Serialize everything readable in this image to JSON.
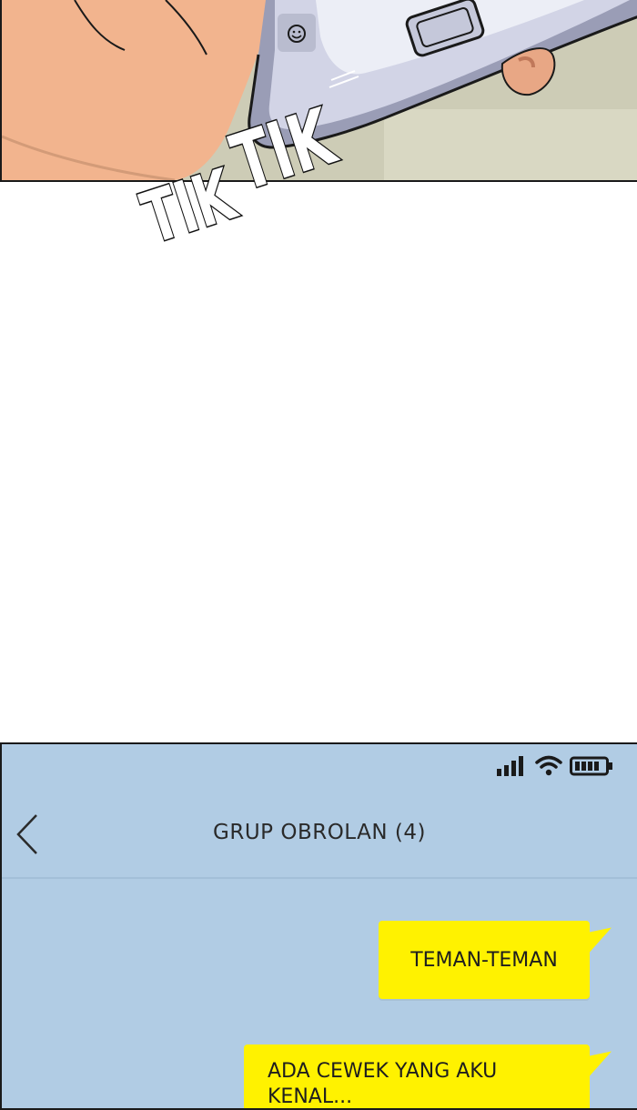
{
  "sfx": {
    "word1": "TIK",
    "word2": "TIK"
  },
  "status_bar": {
    "signal_icon": "signal-bars-icon",
    "wifi_icon": "wifi-icon",
    "battery_icon": "battery-icon"
  },
  "chat": {
    "title": "GRUP OBROLAN (4)",
    "back_icon": "chevron-left-icon",
    "messages": [
      {
        "text": "TEMAN-TEMAN"
      },
      {
        "text": "ADA CEWEK YANG AKU",
        "text_cut": "KENAL..."
      }
    ]
  },
  "colors": {
    "phone_bg": "#b1cce4",
    "bubble": "#fff200",
    "panel_border": "#1a1a1a"
  }
}
